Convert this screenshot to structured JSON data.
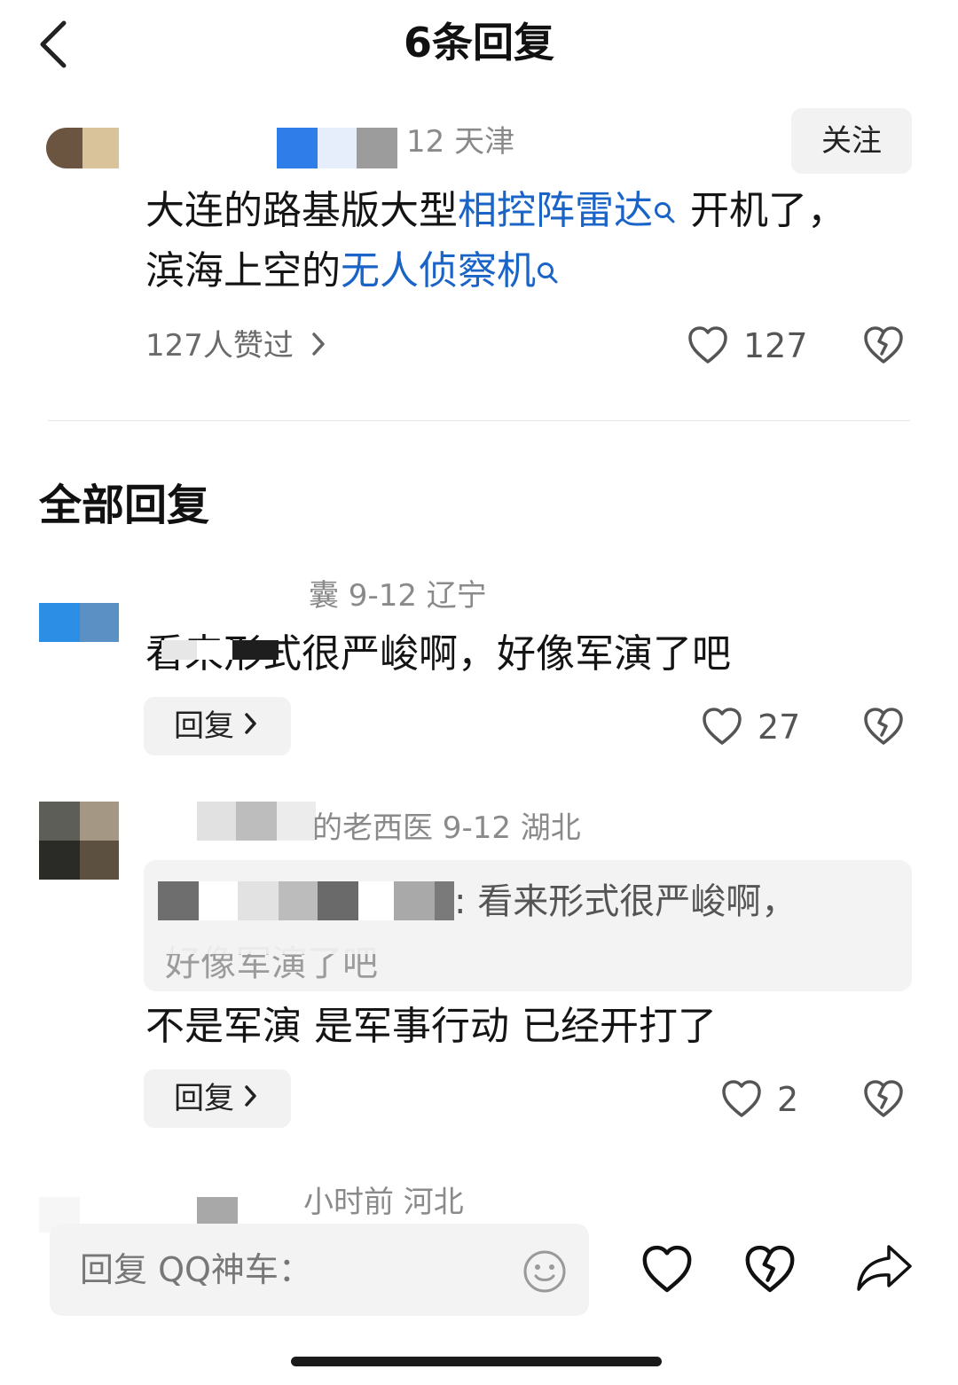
{
  "header": {
    "title": "6条回复"
  },
  "main_comment": {
    "meta": "12  天津",
    "follow_label": "关注",
    "text_parts": [
      "大连的路基版大型",
      "相控阵雷达",
      " 开机了，滨海上空的",
      "无人侦察机"
    ],
    "likes_summary": "127人赞过",
    "like_count": "127"
  },
  "section_title": "全部回复",
  "replies": [
    {
      "meta": "囊  9-12  辽宁",
      "text": "看来形式很严峻啊，好像军演了吧",
      "reply_label": "回复",
      "like_count": "27"
    },
    {
      "meta": "的老西医  9-12  湖北",
      "quote_text": ":  看来形式很严峻啊，",
      "quote_text_cut": "好像军演了吧",
      "text": "不是军演 是军事行动 已经开打了",
      "reply_label": "回复",
      "like_count": "2"
    },
    {
      "meta": "小时前  河北"
    }
  ],
  "bottom_bar": {
    "placeholder": "回复 QQ神车："
  },
  "colors": {
    "link": "#1a63c7",
    "meta_gray": "#8a8a8a",
    "panel_gray": "#f2f2f2"
  },
  "icons": [
    "back-icon",
    "search-icon",
    "chevron-right-icon",
    "heart-icon",
    "broken-heart-icon",
    "smiley-icon",
    "share-icon"
  ]
}
